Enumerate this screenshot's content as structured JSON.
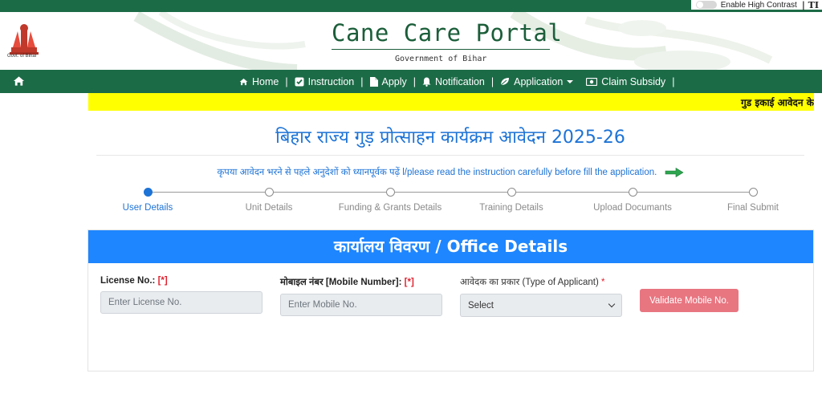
{
  "accessibility": {
    "high_contrast_label": "Enable High Contrast",
    "extra_label": "| TI"
  },
  "header": {
    "govt_label": "Govt. of Bihar",
    "title": "Cane Care Portal",
    "subtitle": "Government of Bihar"
  },
  "nav": {
    "home": "Home",
    "instruction": "Instruction",
    "apply": "Apply",
    "notification": "Notification",
    "application": "Application",
    "claim_subsidy": "Claim Subsidy",
    "separator": "|"
  },
  "marquee": {
    "text": "गुड इकाई आवेदन के"
  },
  "page": {
    "heading_hi": "बिहार राज्य गुड़ प्रोत्साहन कार्यक्रम आवेदन",
    "heading_year": "2025-26",
    "notice": "कृपया आवेदन भरने से पहले अनुदेशों को ध्यानपूर्वक पढ़ें l/please read the instruction carefully before fill the application."
  },
  "steps": [
    {
      "label": "User Details",
      "active": true
    },
    {
      "label": "Unit Details",
      "active": false
    },
    {
      "label": "Funding & Grants Details",
      "active": false
    },
    {
      "label": "Training Details",
      "active": false
    },
    {
      "label": "Upload Documants",
      "active": false
    },
    {
      "label": "Final Submit",
      "active": false
    }
  ],
  "form": {
    "card_title": "कार्यालय विवरण / Office Details",
    "license_label": "License No.:",
    "license_required": "[*]",
    "license_placeholder": "Enter License No.",
    "mobile_label": "मोबाइल नंबर [Mobile Number]:",
    "mobile_required": "[*]",
    "mobile_placeholder": "Enter Mobile No.",
    "applicant_type_label": "आवेदक का प्रकार (Type of Applicant)",
    "applicant_type_required": "*",
    "applicant_type_value": "Select",
    "validate_button": "Validate Mobile No."
  },
  "colors": {
    "brand_green": "#1c6b47",
    "primary_blue": "#1e86ff",
    "link_blue": "#1d73d6",
    "marquee_yellow": "#ffff00",
    "validate_pink": "#e87681"
  }
}
